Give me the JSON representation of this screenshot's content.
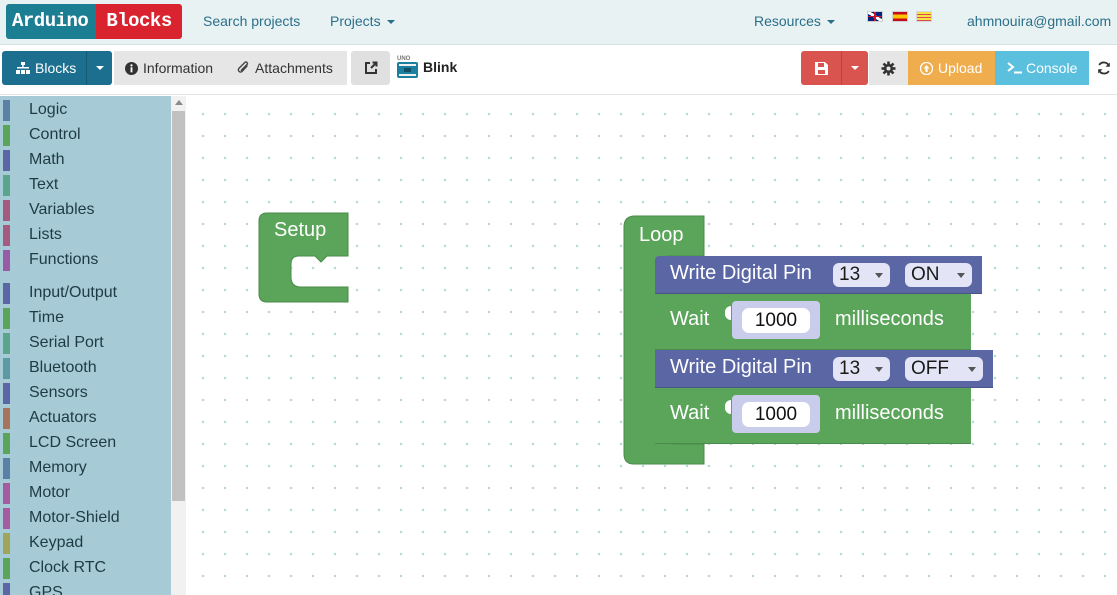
{
  "navbar": {
    "logo_left": "Arduino",
    "logo_right": "Blocks",
    "search_projects": "Search projects",
    "projects": "Projects",
    "resources": "Resources",
    "user_email": "ahmnouira@gmail.com",
    "languages": [
      "English",
      "Español",
      "Català"
    ]
  },
  "toolbar": {
    "blocks_label": "Blocks",
    "information_label": "Information",
    "attachments_label": "Attachments",
    "board_badge": "UNO",
    "project_name": "Blink",
    "upload_label": "Upload",
    "console_label": "Console"
  },
  "sidebar": {
    "categories": [
      {
        "label": "Logic",
        "color": "#5b80a5"
      },
      {
        "label": "Control",
        "color": "#5ba55b"
      },
      {
        "label": "Math",
        "color": "#5b67a5"
      },
      {
        "label": "Text",
        "color": "#5ba58c"
      },
      {
        "label": "Variables",
        "color": "#a55b80"
      },
      {
        "label": "Lists",
        "color": "#a55b80"
      },
      {
        "label": "Functions",
        "color": "#995ba5"
      },
      {
        "label": "Input/Output",
        "color": "#5b67a5"
      },
      {
        "label": "Time",
        "color": "#5ba55b"
      },
      {
        "label": "Serial Port",
        "color": "#5ba58c"
      },
      {
        "label": "Bluetooth",
        "color": "#5b99a5"
      },
      {
        "label": "Sensors",
        "color": "#5b67a5"
      },
      {
        "label": "Actuators",
        "color": "#a5745b"
      },
      {
        "label": "LCD Screen",
        "color": "#5ba55b"
      },
      {
        "label": "Memory",
        "color": "#5b80a5"
      },
      {
        "label": "Motor",
        "color": "#a55ba0"
      },
      {
        "label": "Motor-Shield",
        "color": "#a55ba0"
      },
      {
        "label": "Keypad",
        "color": "#9fa55b"
      },
      {
        "label": "Clock RTC",
        "color": "#5ba55b"
      },
      {
        "label": "GPS",
        "color": "#5b67a5"
      }
    ]
  },
  "workspace": {
    "setup_label": "Setup",
    "loop_label": "Loop",
    "statements": [
      {
        "type": "digital_write",
        "label": "Write Digital Pin",
        "pin": "13",
        "state": "ON"
      },
      {
        "type": "wait",
        "label": "Wait",
        "value": "1000",
        "unit": "milliseconds"
      },
      {
        "type": "digital_write",
        "label": "Write Digital Pin",
        "pin": "13",
        "state": "OFF"
      },
      {
        "type": "wait",
        "label": "Wait",
        "value": "1000",
        "unit": "milliseconds"
      }
    ],
    "colors": {
      "control": "#5ba55b",
      "io": "#5b67a5",
      "time": "#5ba55b"
    }
  }
}
